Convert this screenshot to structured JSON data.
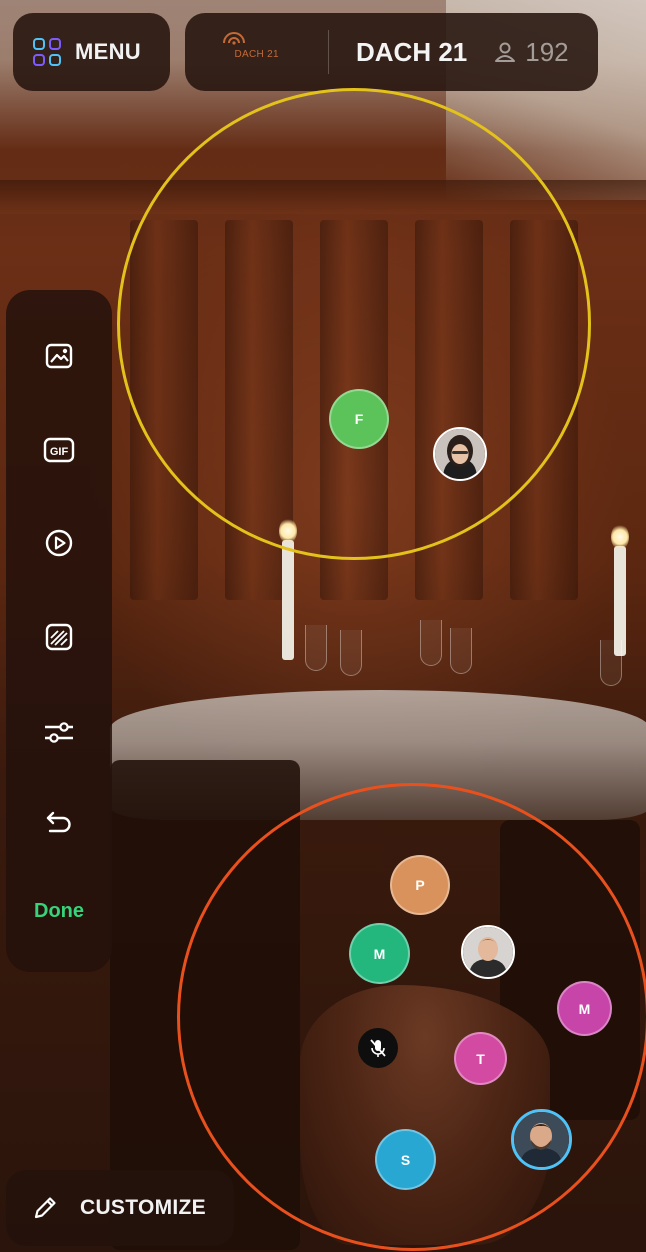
{
  "topbar": {
    "menu_label": "MENU",
    "event_logo_text": "DACH 21",
    "event_name": "DACH 21",
    "attendee_count": "192",
    "menu_icon_colors": [
      "#4fc3f7",
      "#7c5cff",
      "#4fc3f7",
      "#7c5cff"
    ]
  },
  "toolbar": {
    "tools": [
      {
        "name": "image-icon"
      },
      {
        "name": "gif-icon"
      },
      {
        "name": "video-play-icon"
      },
      {
        "name": "background-pattern-icon"
      },
      {
        "name": "sliders-icon"
      },
      {
        "name": "undo-icon"
      }
    ],
    "done_label": "Done",
    "done_color": "#38d27a"
  },
  "customize": {
    "label": "CUSTOMIZE",
    "icon": "pencil-icon"
  },
  "circles": {
    "top": {
      "color": "#e3c21b",
      "members": [
        {
          "initial": "F",
          "color": "#5cc35a"
        }
      ]
    },
    "bottom": {
      "color": "#e8511d",
      "members": [
        {
          "initial": "P",
          "color": "#d9925b"
        },
        {
          "initial": "M",
          "color": "#23b77e"
        },
        {
          "initial": "M",
          "color": "#c744a8"
        },
        {
          "initial": "T",
          "color": "#d24aa2"
        },
        {
          "initial": "S",
          "color": "#28a7d3"
        }
      ]
    }
  }
}
